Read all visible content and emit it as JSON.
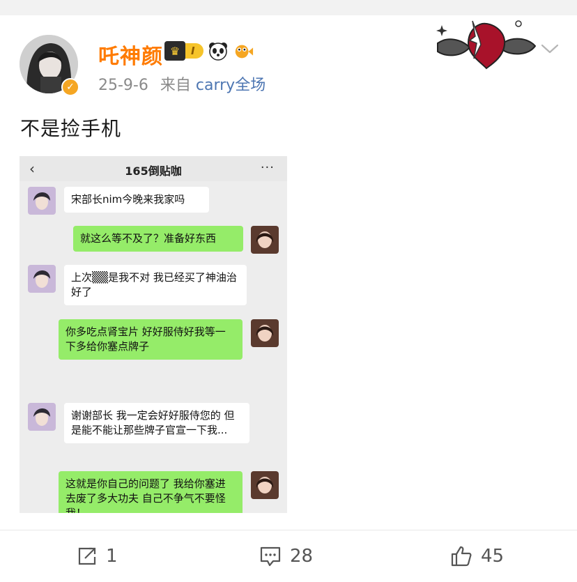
{
  "post": {
    "username": "吒神颜",
    "level_badge": "I",
    "date": "25-9-6",
    "source_prefix": "来自",
    "source": "carry全场",
    "text": "不是捡手机"
  },
  "screenshot": {
    "chat_title": "165倒贴咖",
    "back_icon": "‹",
    "more_icon": "···",
    "messages": [
      {
        "side": "left",
        "text": "宋部长nim今晚来我家吗"
      },
      {
        "side": "right",
        "text": "就这么等不及了？准备好东西"
      },
      {
        "side": "left",
        "text": "上次▒▒是我不对 我已经买了神油治好了"
      },
      {
        "side": "right",
        "text": "你多吃点肾宝片 好好服侍好我等一下多给你塞点牌子"
      },
      {
        "side": "left",
        "text": "谢谢部长 我一定会好好服侍您的 但是能不能让那些牌子官宣一下我..."
      },
      {
        "side": "right",
        "text": "这就是你自己的问题了 我给你塞进去废了多大功夫 自己不争气不要怪我！"
      }
    ]
  },
  "actions": {
    "share_count": "1",
    "comment_count": "28",
    "like_count": "45"
  },
  "colors": {
    "username": "#ff7b00",
    "source_link": "#4d76b2",
    "bubble_right": "#95ec69",
    "bubble_left": "#ffffff"
  }
}
